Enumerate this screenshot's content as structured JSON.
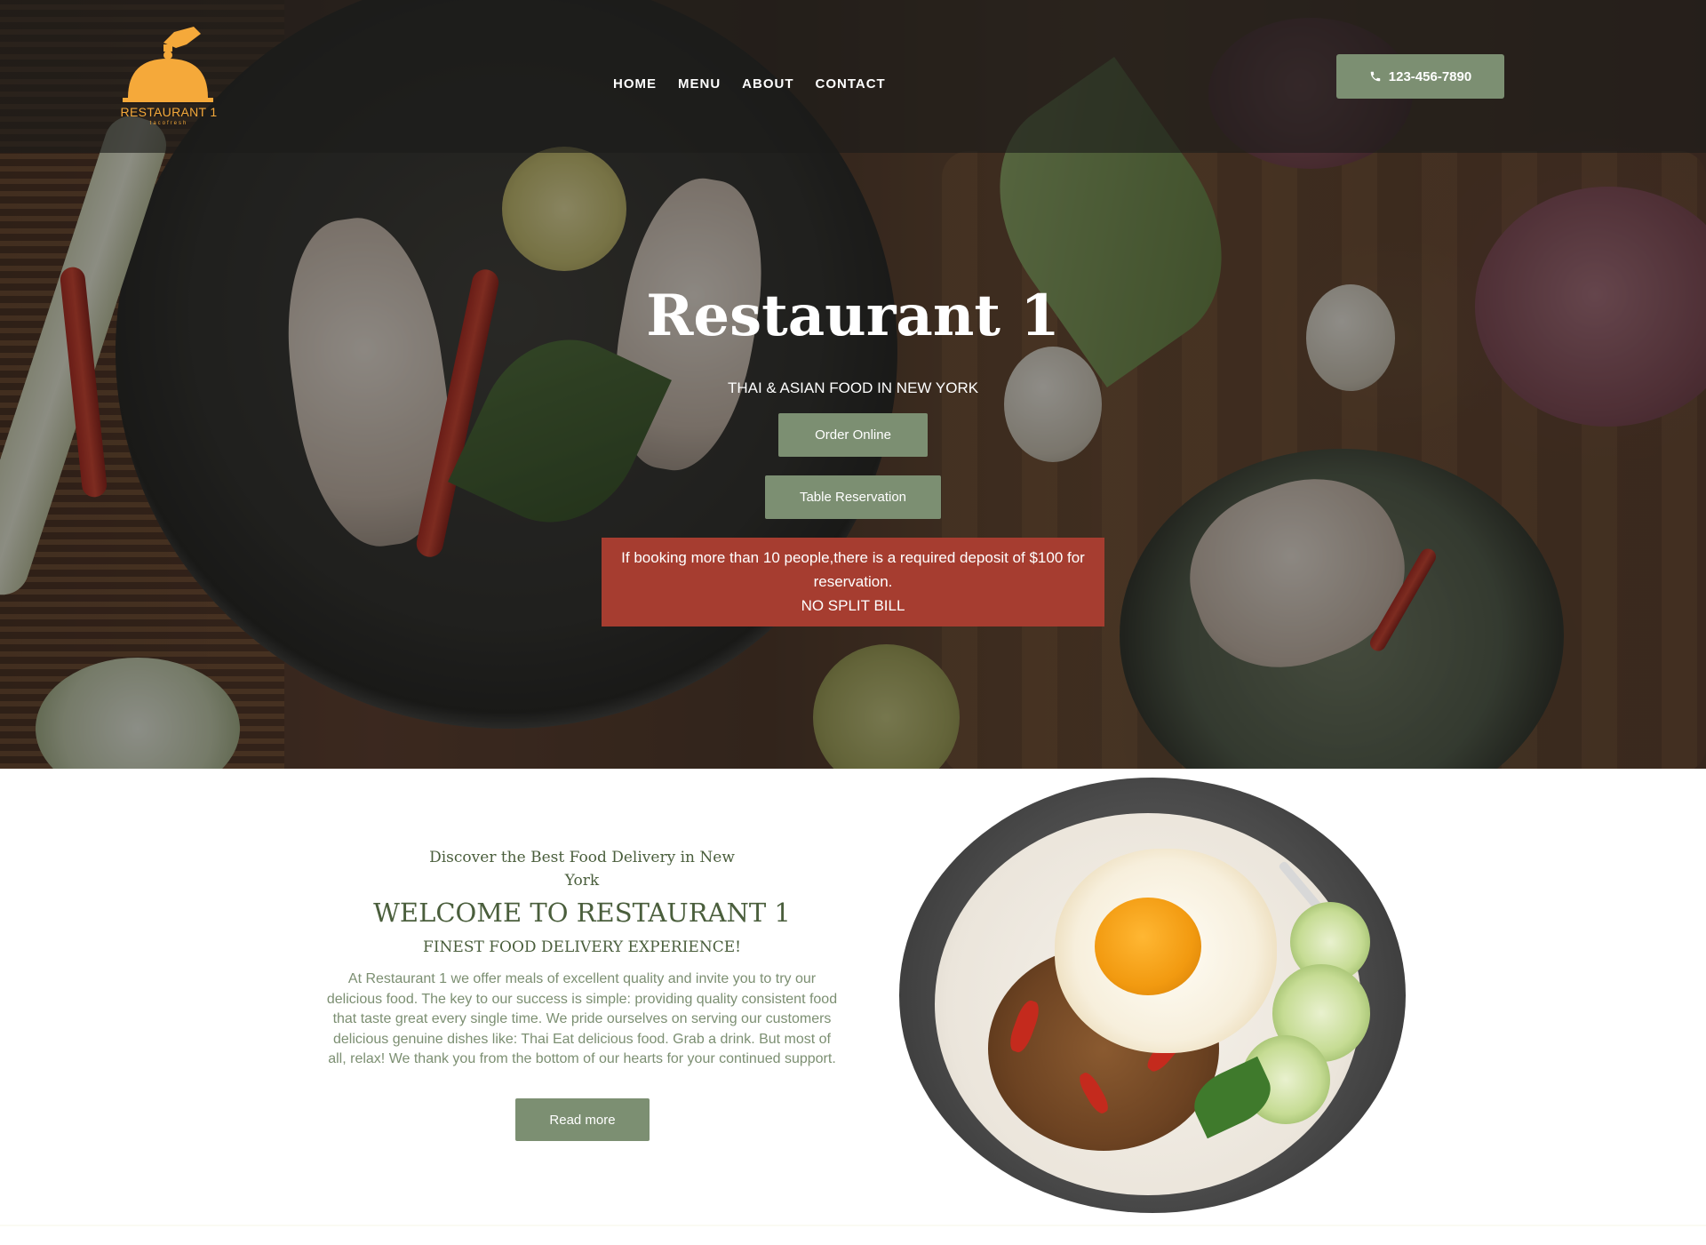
{
  "header": {
    "logo_text": "RESTAURANT 1",
    "logo_sub": "tacofresh",
    "nav": [
      "HOME",
      "MENU",
      "ABOUT",
      "CONTACT"
    ],
    "phone": "123-456-7890"
  },
  "hero": {
    "title": "Restaurant 1",
    "subtitle": "THAI & ASIAN FOOD IN NEW YORK",
    "order_online": "Order Online",
    "table_reservation": "Table Reservation",
    "notice_line1": "If booking more than 10 people,there is a required deposit of $100 for reservation.",
    "notice_line2": "NO SPLIT BILL"
  },
  "welcome": {
    "discover": "Discover the Best Food Delivery in New York",
    "title": "WELCOME TO RESTAURANT 1",
    "finest": "FINEST FOOD DELIVERY EXPERIENCE!",
    "body": "At Restaurant 1 we offer meals of excellent quality and invite you to try our delicious food. The key to our success is simple: providing quality consistent food that taste great every single time. We pride ourselves on serving our customers delicious genuine dishes like: Thai Eat delicious food. Grab a drink. But most of all, relax! We thank you from the bottom of our hearts for your continued support.",
    "read_more": "Read more"
  },
  "colors": {
    "accent_green": "#7c8f72",
    "heading_green": "#4a5e3c",
    "notice_red": "#a63d30",
    "logo_orange": "#f5a93a"
  },
  "icons": {
    "logo": "cloche-icon",
    "phone": "phone-icon"
  }
}
